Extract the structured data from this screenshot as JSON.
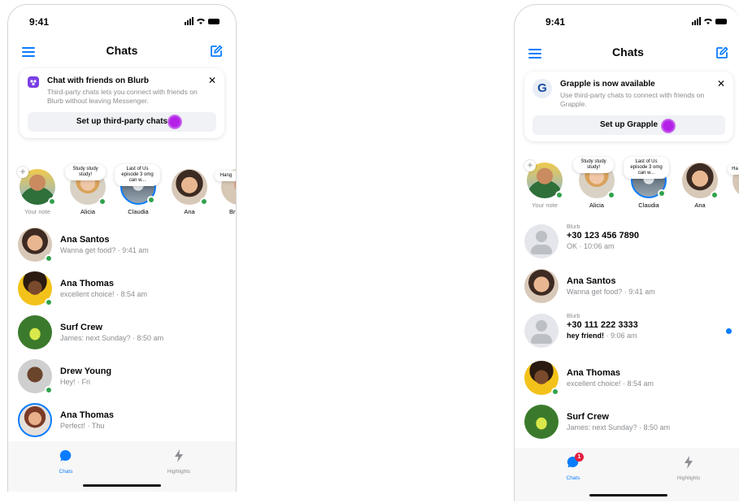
{
  "status": {
    "time": "9:41"
  },
  "left": {
    "title": "Chats",
    "card": {
      "title": "Chat with friends on Blurb",
      "body": "Third-party chats lets you connect with friends on Blurb without leaving Messenger.",
      "button": "Set up third-party chats"
    },
    "stories": [
      {
        "name": "Your note",
        "note": ""
      },
      {
        "name": "Alicia",
        "note": "Study study study!"
      },
      {
        "name": "Claudia",
        "note": "Last of Us episode 3 omg can w..."
      },
      {
        "name": "Ana",
        "note": ""
      },
      {
        "name": "Br",
        "note": "Hang"
      }
    ],
    "chats": [
      {
        "name": "Ana Santos",
        "preview": "Wanna get food? · 9:41 am"
      },
      {
        "name": "Ana Thomas",
        "preview": "excellent choice! · 8:54 am"
      },
      {
        "name": "Surf Crew",
        "preview": "James: next Sunday? · 8:50 am"
      },
      {
        "name": "Drew Young",
        "preview": "Hey! · Fri"
      },
      {
        "name": "Ana Thomas",
        "preview": "Perfect! · Thu"
      }
    ],
    "tabs": {
      "chats": "Chats",
      "highlights": "Highlights"
    }
  },
  "right": {
    "title": "Chats",
    "card": {
      "icon_letter": "G",
      "title": "Grapple is now available",
      "body": "Use third-party chats to connect with friends on Grapple.",
      "button": "Set up Grapple"
    },
    "stories": [
      {
        "name": "Your note",
        "note": ""
      },
      {
        "name": "Alicia",
        "note": "Study study study!"
      },
      {
        "name": "Claudia",
        "note": "Last of Us episode 3 omg can w..."
      },
      {
        "name": "Ana",
        "note": ""
      },
      {
        "name": "",
        "note": "Ha"
      }
    ],
    "chats": [
      {
        "source": "Blurb",
        "name": "+30 123 456 7890",
        "preview": "OK · 10:06 am"
      },
      {
        "source": "",
        "name": "Ana Santos",
        "preview": "Wanna get food? · 9:41 am"
      },
      {
        "source": "Blurb",
        "name": "+30 111 222 3333",
        "preview_bold": "hey friend!",
        "preview": " · 9:06 am"
      },
      {
        "source": "",
        "name": "Ana Thomas",
        "preview": "excellent choice! · 8:54 am"
      },
      {
        "source": "",
        "name": "Surf Crew",
        "preview": "James: next Sunday? · 8:50 am"
      }
    ],
    "tabs": {
      "chats": "Chats",
      "highlights": "Highlights",
      "badge": "1"
    }
  },
  "colors": {
    "accent": "#0a7cff",
    "online": "#31a24c",
    "badge": "#e41e3f",
    "cursor": "#b420e8"
  }
}
